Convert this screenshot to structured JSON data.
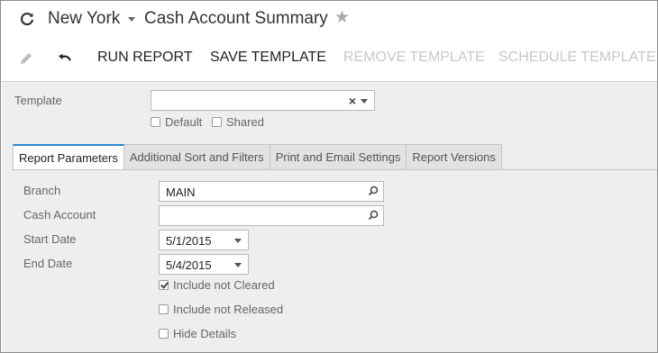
{
  "header": {
    "company": "New York",
    "screen_title": "Cash Account Summary"
  },
  "toolbar": {
    "run_report": "RUN REPORT",
    "save_template": "SAVE TEMPLATE",
    "remove_template": "REMOVE TEMPLATE",
    "schedule_template": "SCHEDULE TEMPLATE"
  },
  "template": {
    "label": "Template",
    "value": "",
    "default_label": "Default",
    "shared_label": "Shared"
  },
  "tabs": [
    {
      "label": "Report Parameters",
      "active": true
    },
    {
      "label": "Additional Sort and Filters",
      "active": false
    },
    {
      "label": "Print and Email Settings",
      "active": false
    },
    {
      "label": "Report Versions",
      "active": false
    }
  ],
  "params": {
    "branch_label": "Branch",
    "branch_value": "MAIN",
    "cash_account_label": "Cash Account",
    "cash_account_value": "",
    "start_date_label": "Start Date",
    "start_date_value": "5/1/2015",
    "end_date_label": "End Date",
    "end_date_value": "5/4/2015",
    "include_not_cleared": {
      "label": "Include not Cleared",
      "checked": true
    },
    "include_not_released": {
      "label": "Include not Released",
      "checked": false
    },
    "hide_details": {
      "label": "Hide Details",
      "checked": false
    }
  },
  "colors": {
    "accent": "#2e87d0",
    "disabled_text": "#c8c8c8",
    "panel_bg": "#eeeeee"
  },
  "icons": [
    "refresh-icon",
    "chevron-down-icon",
    "star-icon",
    "edit-icon",
    "undo-icon",
    "clear-icon",
    "search-icon"
  ]
}
